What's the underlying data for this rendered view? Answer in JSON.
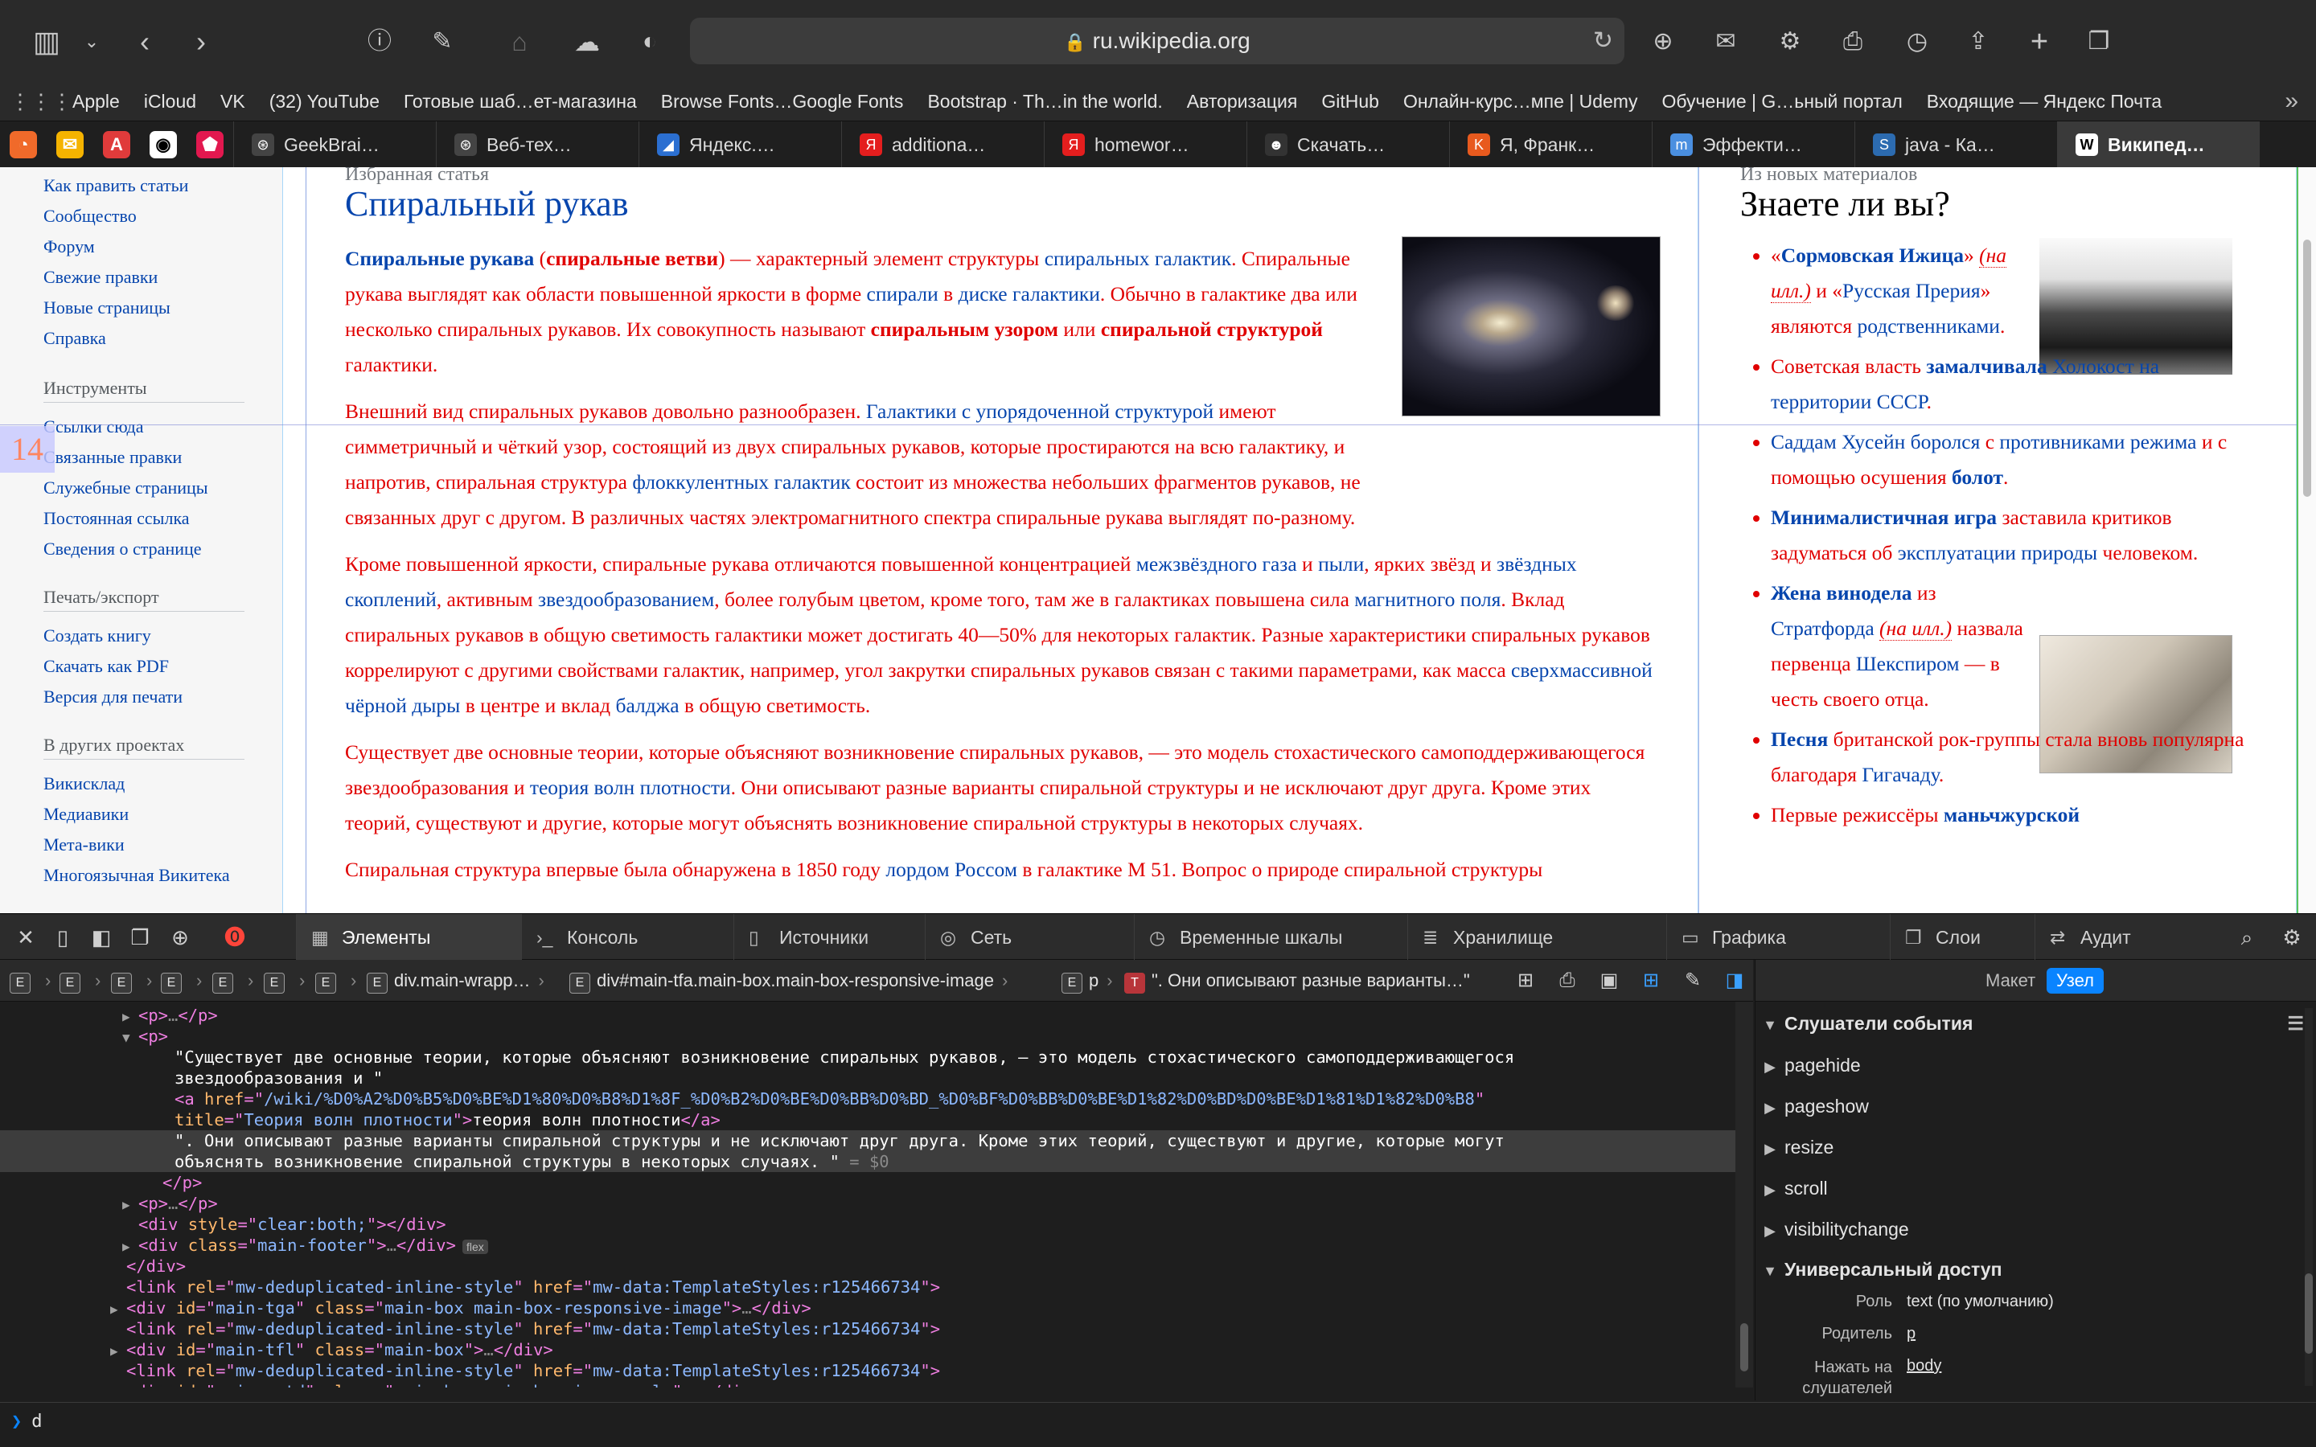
{
  "browser": {
    "url": "ru.wikipedia.org",
    "toolbar_icons": [
      "sidebar-icon",
      "chevron-down-icon",
      "back-icon",
      "forward-icon",
      "info-icon",
      "reader-icon",
      "home-icon",
      "cloud-icon",
      "shield-icon",
      "download-icon",
      "mail-icon",
      "gear-icon",
      "print-icon",
      "history-icon",
      "share-icon",
      "new-tab-icon",
      "tabs-overview-icon"
    ]
  },
  "bookmarks": [
    "Apple",
    "iCloud",
    "VK",
    "(32) YouTube",
    "Готовые шаб…ет-магазина",
    "Browse Fonts…Google Fonts",
    "Bootstrap · Th…in the world.",
    "Авторизация",
    "GitHub",
    "Онлайн-курс…мпе | Udemy",
    "Обучение | G…ьный портал",
    "Входящие — Яндекс Почта"
  ],
  "tabs": [
    {
      "label": "GeekBrai…",
      "fav": "⊛",
      "color": "#444"
    },
    {
      "label": "Веб-тех…",
      "fav": "⊛",
      "color": "#444"
    },
    {
      "label": "Яндекс.…",
      "fav": "◢",
      "color": "#2b6fd1"
    },
    {
      "label": "additiona…",
      "fav": "Я",
      "color": "#e41e1e"
    },
    {
      "label": "homewor…",
      "fav": "Я",
      "color": "#e41e1e"
    },
    {
      "label": "Скачать…",
      "fav": "☻",
      "color": "#333"
    },
    {
      "label": "Я, Франк…",
      "fav": "K",
      "color": "#e85a1e"
    },
    {
      "label": "Эффекти…",
      "fav": "m",
      "color": "#4a8fe0"
    },
    {
      "label": "java - Ка…",
      "fav": "S",
      "color": "#2c6bb0"
    },
    {
      "label": "Википед…",
      "fav": "W",
      "color": "#fff"
    }
  ],
  "sidebar": {
    "top_links": [
      "Как править статьи",
      "Сообщество",
      "Форум",
      "Свежие правки",
      "Новые страницы",
      "Справка"
    ],
    "tools_heading": "Инструменты",
    "tools_links": [
      "Ссылки сюда",
      "Связанные правки",
      "Служебные страницы",
      "Постоянная ссылка",
      "Сведения о странице"
    ],
    "export_heading": "Печать/экспорт",
    "export_links": [
      "Создать книгу",
      "Скачать как PDF",
      "Версия для печати"
    ],
    "projects_heading": "В других проектах",
    "projects_links": [
      "Викисклад",
      "Медиавики",
      "Мета-вики",
      "Многоязычная Викитека"
    ],
    "overlay_number": "14"
  },
  "article": {
    "header": "Избранная статья",
    "title": "Спиральный рукав",
    "image_alt": "galaxy photo",
    "paragraphs": [
      [
        {
          "t": "Спиральные рукава",
          "s": "b strong"
        },
        {
          "t": " ("
        },
        {
          "t": "спиральные ветви",
          "s": "strong"
        },
        {
          "t": ") — характерный элемент структуры "
        },
        {
          "t": "спиральных галактик",
          "s": "b"
        },
        {
          "t": ". Спиральные рукава выглядят как области повышенной яркости в форме "
        },
        {
          "t": "спирали",
          "s": "b"
        },
        {
          "t": " в "
        },
        {
          "t": "диске галактики",
          "s": "b"
        },
        {
          "t": ". Обычно в галактике два или несколько спиральных рукавов. Их совокупность называют "
        },
        {
          "t": "спиральным узором",
          "s": "strong"
        },
        {
          "t": " или "
        },
        {
          "t": "спиральной структурой",
          "s": "strong"
        },
        {
          "t": " галактики."
        }
      ],
      [
        {
          "t": "Внешний вид спиральных рукавов довольно разнообразен. "
        },
        {
          "t": "Галактики с упорядоченной структурой",
          "s": "b"
        },
        {
          "t": " имеют симметричный и чёткий узор, состоящий из двух спиральных рукавов, которые простираются на всю галактику, и напротив, спиральная структура "
        },
        {
          "t": "флоккулентных галактик",
          "s": "b"
        },
        {
          "t": " состоит из множества небольших фрагментов рукавов, не связанных друг с другом. В различных частях электромагнитного спектра спиральные рукава выглядят по-разному."
        }
      ],
      [
        {
          "t": "Кроме повышенной яркости, спиральные рукава отличаются повышенной концентрацией "
        },
        {
          "t": "межзвёздного газа",
          "s": "b"
        },
        {
          "t": " и "
        },
        {
          "t": "пыли",
          "s": "b"
        },
        {
          "t": ", ярких звёзд и "
        },
        {
          "t": "звёздных скоплений",
          "s": "b"
        },
        {
          "t": ", активным "
        },
        {
          "t": "звездообразованием",
          "s": "b"
        },
        {
          "t": ", более голубым цветом, кроме того, там же в галактиках повышена сила "
        },
        {
          "t": "магнитного поля",
          "s": "b"
        },
        {
          "t": ". Вклад спиральных рукавов в общую светимость галактики может достигать 40—50% для некоторых галактик. Разные характеристики спиральных рукавов коррелируют с другими свойствами галактик, например, угол закрутки спиральных рукавов связан с такими параметрами, как масса "
        },
        {
          "t": "сверхмассивной чёрной дыры",
          "s": "b"
        },
        {
          "t": " в центре и вклад "
        },
        {
          "t": "балджа",
          "s": "b"
        },
        {
          "t": " в общую светимость."
        }
      ],
      [
        {
          "t": "Существует две основные теории, которые объясняют возникновение спиральных рукавов, — это модель стохастического самоподдерживающегося звездообразования и "
        },
        {
          "t": "теория волн плотности",
          "s": "b"
        },
        {
          "t": ". Они описывают разные варианты спиральной структуры и не исключают друг друга. Кроме этих теорий, существуют и другие, которые могут объяснять возникновение спиральной структуры в некоторых случаях."
        }
      ],
      [
        {
          "t": "Спиральная структура впервые была обнаружена в 1850 году "
        },
        {
          "t": "лордом Россом",
          "s": "b"
        },
        {
          "t": " в галактике M 51. Вопрос о природе спиральной структуры"
        }
      ]
    ]
  },
  "dyk": {
    "header": "Из новых материалов",
    "title": "Знаете ли вы?",
    "items": [
      [
        {
          "t": "«"
        },
        {
          "t": "Сормовская Ижица",
          "s": "b strong"
        },
        {
          "t": "» "
        },
        {
          "t": "(на илл.)",
          "s": "i"
        },
        {
          "t": " и «"
        },
        {
          "t": "Русская Прерия",
          "s": "b"
        },
        {
          "t": "» являются "
        },
        {
          "t": "родственниками",
          "s": "b"
        },
        {
          "t": "."
        }
      ],
      [
        {
          "t": "Советская власть "
        },
        {
          "t": "замалчивала",
          "s": "b strong"
        },
        {
          "t": " "
        },
        {
          "t": "Холокост на территории СССР",
          "s": "b"
        },
        {
          "t": "."
        }
      ],
      [
        {
          "t": "Саддам Хусейн",
          "s": "b"
        },
        {
          "t": " "
        },
        {
          "t": "боролся",
          "s": "b"
        },
        {
          "t": " с "
        },
        {
          "t": "противниками режима",
          "s": "b"
        },
        {
          "t": " и с помощью осушения "
        },
        {
          "t": "болот",
          "s": "b strong"
        },
        {
          "t": "."
        }
      ],
      [
        {
          "t": "Минималистичная игра",
          "s": "b strong"
        },
        {
          "t": " заставила критиков задуматься об "
        },
        {
          "t": "эксплуатации природы",
          "s": "b"
        },
        {
          "t": " человеком."
        }
      ],
      [
        {
          "t": "Жена винодела",
          "s": "b strong"
        },
        {
          "t": " из "
        },
        {
          "t": "Стратфорда",
          "s": "b"
        },
        {
          "t": " "
        },
        {
          "t": "(на илл.)",
          "s": "i"
        },
        {
          "t": " назвала первенца "
        },
        {
          "t": "Шекспиром",
          "s": "b"
        },
        {
          "t": " — в честь своего отца."
        }
      ],
      [
        {
          "t": "Песня",
          "s": "b strong"
        },
        {
          "t": " британской рок-группы стала вновь популярна благодаря "
        },
        {
          "t": "Гигачаду",
          "s": "b"
        },
        {
          "t": "."
        }
      ],
      [
        {
          "t": "Первые режиссёры "
        },
        {
          "t": "маньчжурской",
          "s": "b strong"
        }
      ]
    ]
  },
  "inspector": {
    "tabs": [
      {
        "label": "Элементы",
        "icon": "▦"
      },
      {
        "label": "Консоль",
        "icon": "›_"
      },
      {
        "label": "Источники",
        "icon": "▯"
      },
      {
        "label": "Сеть",
        "icon": "◎"
      },
      {
        "label": "Временные шкалы",
        "icon": "◷"
      },
      {
        "label": "Хранилище",
        "icon": "≣"
      },
      {
        "label": "Графика",
        "icon": "▭"
      },
      {
        "label": "Слои",
        "icon": "❐"
      },
      {
        "label": "Аудит",
        "icon": "⇄"
      }
    ],
    "breadcrumb": {
      "wrapper": "div.main-wrapp…",
      "box": "div#main-tfa.main-box.main-box-responsive-image",
      "p": "p",
      "text": "\". Они описывают разные варианты…\""
    },
    "dom_lines": [
      {
        "indent": 10,
        "arrow": "▶",
        "html": [
          [
            "tag",
            "<p>"
          ],
          [
            "grey",
            "…"
          ],
          [
            "tag",
            "</p>"
          ]
        ]
      },
      {
        "indent": 10,
        "arrow": "▼",
        "html": [
          [
            "tag",
            "<p>"
          ]
        ]
      },
      {
        "indent": 13,
        "arrow": "",
        "html": [
          [
            "txt",
            "\"Существует две основные теории, которые объясняют возникновение спиральных рукавов, — это модель стохастического самоподдерживающегося"
          ]
        ]
      },
      {
        "indent": 13,
        "arrow": "",
        "html": [
          [
            "txt",
            "звездообразования и \""
          ]
        ]
      },
      {
        "indent": 13,
        "arrow": "",
        "html": [
          [
            "tag",
            "<a "
          ],
          [
            "attr",
            "href"
          ],
          [
            "tag",
            "=\""
          ],
          [
            "val",
            "/wiki/%D0%A2%D0%B5%D0%BE%D1%80%D0%B8%D1%8F_%D0%B2%D0%BE%D0%BB%D0%BD_%D0%BF%D0%BB%D0%BE%D1%82%D0%BD%D0%BE%D1%81%D1%82%D0%B8"
          ],
          [
            "tag",
            "\""
          ]
        ]
      },
      {
        "indent": 13,
        "arrow": "",
        "html": [
          [
            "attr",
            "title"
          ],
          [
            "tag",
            "=\""
          ],
          [
            "val",
            "Теория волн плотности"
          ],
          [
            "tag",
            "\">"
          ],
          [
            "txt",
            "теория волн плотности"
          ],
          [
            "tag",
            "</a>"
          ]
        ]
      },
      {
        "indent": 13,
        "arrow": "",
        "sel": true,
        "html": [
          [
            "txt",
            "\". Они описывают разные варианты спиральной структуры и не исключают друг друга. Кроме этих теорий, существуют и другие, которые могут"
          ]
        ]
      },
      {
        "indent": 13,
        "arrow": "",
        "sel": true,
        "html": [
          [
            "txt",
            "объяснять возникновение спиральной структуры в некоторых случаях. \""
          ],
          [
            "grey",
            " = $0"
          ]
        ]
      },
      {
        "indent": 12,
        "arrow": "",
        "html": [
          [
            "tag",
            "</p>"
          ]
        ]
      },
      {
        "indent": 10,
        "arrow": "▶",
        "html": [
          [
            "tag",
            "<p>"
          ],
          [
            "grey",
            "…"
          ],
          [
            "tag",
            "</p>"
          ]
        ]
      },
      {
        "indent": 10,
        "arrow": "",
        "html": [
          [
            "tag",
            "<div "
          ],
          [
            "attr",
            "style"
          ],
          [
            "tag",
            "=\""
          ],
          [
            "val",
            "clear:both;"
          ],
          [
            "tag",
            "\"></div>"
          ]
        ]
      },
      {
        "indent": 10,
        "arrow": "▶",
        "html": [
          [
            "tag",
            "<div "
          ],
          [
            "attr",
            "class"
          ],
          [
            "tag",
            "=\""
          ],
          [
            "val",
            "main-footer"
          ],
          [
            "tag",
            "\">"
          ],
          [
            "grey",
            "…"
          ],
          [
            "tag",
            "</div>"
          ],
          [
            "badge",
            "flex"
          ]
        ]
      },
      {
        "indent": 9,
        "arrow": "",
        "html": [
          [
            "tag",
            "</div>"
          ]
        ]
      },
      {
        "indent": 9,
        "arrow": "",
        "html": [
          [
            "tag",
            "<link "
          ],
          [
            "attr",
            "rel"
          ],
          [
            "tag",
            "=\""
          ],
          [
            "val",
            "mw-deduplicated-inline-style"
          ],
          [
            "tag",
            "\" "
          ],
          [
            "attr",
            "href"
          ],
          [
            "tag",
            "=\""
          ],
          [
            "val",
            "mw-data:TemplateStyles:r125466734"
          ],
          [
            "tag",
            "\">"
          ]
        ]
      },
      {
        "indent": 9,
        "arrow": "▶",
        "html": [
          [
            "tag",
            "<div "
          ],
          [
            "attr",
            "id"
          ],
          [
            "tag",
            "=\""
          ],
          [
            "val",
            "main-tga"
          ],
          [
            "tag",
            "\" "
          ],
          [
            "attr",
            "class"
          ],
          [
            "tag",
            "=\""
          ],
          [
            "val",
            "main-box main-box-responsive-image"
          ],
          [
            "tag",
            "\">"
          ],
          [
            "grey",
            "…"
          ],
          [
            "tag",
            "</div>"
          ]
        ]
      },
      {
        "indent": 9,
        "arrow": "",
        "html": [
          [
            "tag",
            "<link "
          ],
          [
            "attr",
            "rel"
          ],
          [
            "tag",
            "=\""
          ],
          [
            "val",
            "mw-deduplicated-inline-style"
          ],
          [
            "tag",
            "\" "
          ],
          [
            "attr",
            "href"
          ],
          [
            "tag",
            "=\""
          ],
          [
            "val",
            "mw-data:TemplateStyles:r125466734"
          ],
          [
            "tag",
            "\">"
          ]
        ]
      },
      {
        "indent": 9,
        "arrow": "▶",
        "html": [
          [
            "tag",
            "<div "
          ],
          [
            "attr",
            "id"
          ],
          [
            "tag",
            "=\""
          ],
          [
            "val",
            "main-tfl"
          ],
          [
            "tag",
            "\" "
          ],
          [
            "attr",
            "class"
          ],
          [
            "tag",
            "=\""
          ],
          [
            "val",
            "main-box"
          ],
          [
            "tag",
            "\">"
          ],
          [
            "grey",
            "…"
          ],
          [
            "tag",
            "</div>"
          ]
        ]
      },
      {
        "indent": 9,
        "arrow": "",
        "html": [
          [
            "tag",
            "<link "
          ],
          [
            "attr",
            "rel"
          ],
          [
            "tag",
            "=\""
          ],
          [
            "val",
            "mw-deduplicated-inline-style"
          ],
          [
            "tag",
            "\" "
          ],
          [
            "attr",
            "href"
          ],
          [
            "tag",
            "=\""
          ],
          [
            "val",
            "mw-data:TemplateStyles:r125466734"
          ],
          [
            "tag",
            "\">"
          ]
        ]
      },
      {
        "indent": 9,
        "arrow": "▶",
        "html": [
          [
            "tag",
            "<div "
          ],
          [
            "attr",
            "id"
          ],
          [
            "tag",
            "=\""
          ],
          [
            "val",
            "main-potd"
          ],
          [
            "tag",
            "\" "
          ],
          [
            "attr",
            "class"
          ],
          [
            "tag",
            "=\""
          ],
          [
            "val",
            "main-box main-box-image-only"
          ],
          [
            "tag",
            "\">"
          ],
          [
            "grey",
            "…"
          ],
          [
            "tag",
            "</div>"
          ]
        ]
      }
    ],
    "side": {
      "seg_layout": "Макет",
      "seg_node": "Узел",
      "listeners_title": "Слушатели события",
      "events": [
        "pagehide",
        "pageshow",
        "resize",
        "scroll",
        "visibilitychange"
      ],
      "access_title": "Универсальный доступ",
      "role_key": "Роль",
      "role_val": "text (по умолчанию)",
      "parent_key": "Родитель",
      "parent_val": "p",
      "click_key": "Нажать на слушателей",
      "click_val": "body"
    },
    "console_input": "d"
  }
}
